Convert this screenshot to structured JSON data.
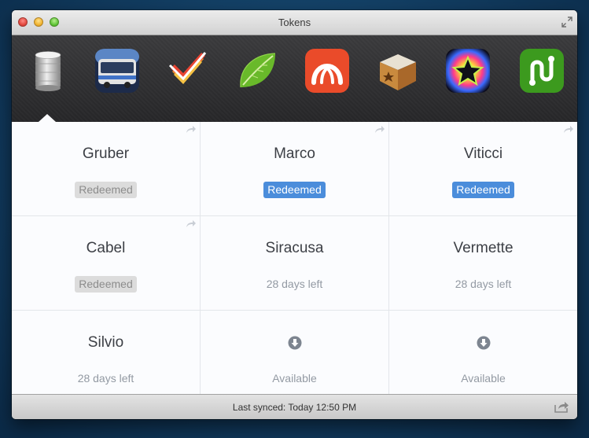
{
  "window": {
    "title": "Tokens"
  },
  "toolbar": {
    "apps": [
      {
        "icon": "server-cylinder-icon",
        "selected": true
      },
      {
        "icon": "transit-bus-icon",
        "selected": false
      },
      {
        "icon": "checkmark-stack-icon",
        "selected": false
      },
      {
        "icon": "green-leaf-icon",
        "selected": false
      },
      {
        "icon": "red-arch-logo-icon",
        "selected": false
      },
      {
        "icon": "open-box-star-icon",
        "selected": false
      },
      {
        "icon": "rainbow-star-icon",
        "selected": false
      },
      {
        "icon": "green-path-logo-icon",
        "selected": false
      }
    ]
  },
  "tokens": [
    {
      "name": "Gruber",
      "status": "Redeemed",
      "badge": "gray"
    },
    {
      "name": "Marco",
      "status": "Redeemed",
      "badge": "blue"
    },
    {
      "name": "Viticci",
      "status": "Redeemed",
      "badge": "blue"
    },
    {
      "name": "Cabel",
      "status": "Redeemed",
      "badge": "gray"
    },
    {
      "name": "Siracusa",
      "status": "28 days left"
    },
    {
      "name": "Vermette",
      "status": "28 days left"
    },
    {
      "name": "Silvio",
      "status": "28 days left"
    },
    {
      "status": "Available",
      "icon": "download-icon"
    },
    {
      "status": "Available",
      "icon": "download-icon"
    }
  ],
  "statusbar": {
    "sync_text": "Last synced: Today 12:50 PM"
  },
  "colors": {
    "badge_blue": "#4b8ddb",
    "badge_gray": "#dcdcdc",
    "toolbar_bg": "#2d2d2f"
  }
}
